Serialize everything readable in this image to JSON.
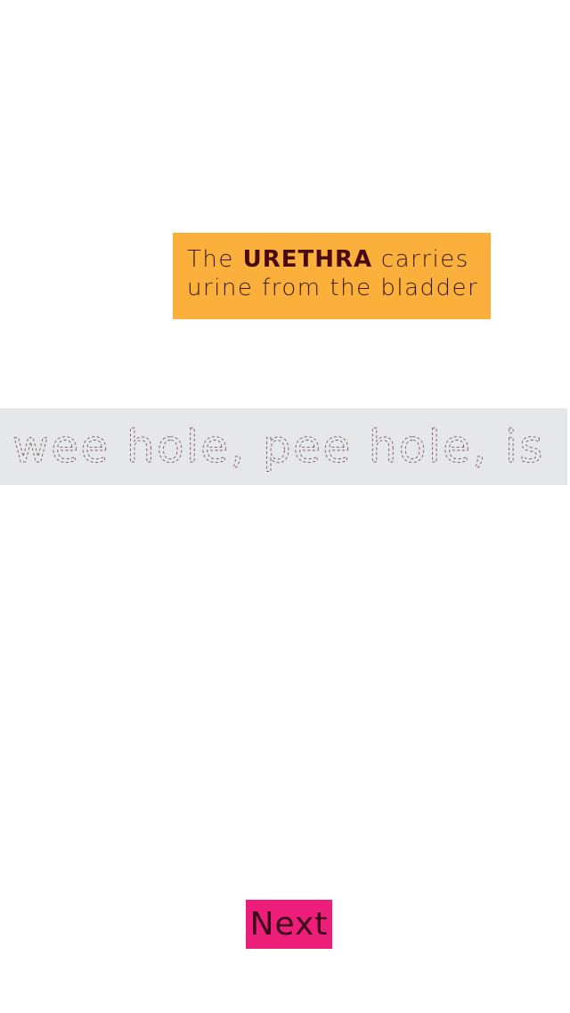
{
  "fact": {
    "prefix": "The",
    "keyword": "URETHRA",
    "suffix": "carries",
    "line2": "urine from the bladder"
  },
  "trace": {
    "text": "wee hole, pee hole, is it?"
  },
  "nav": {
    "next_label": "Next"
  },
  "colors": {
    "card": "#fbb03b",
    "band": "#e6e7e8",
    "button": "#ed1e79"
  }
}
